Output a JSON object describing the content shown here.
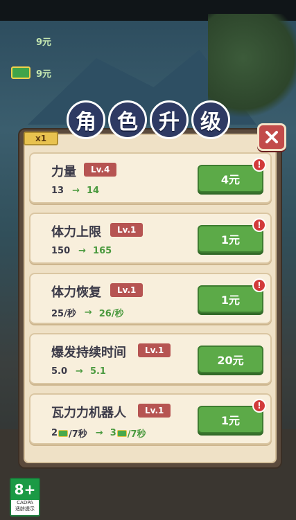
{
  "top_coins": [
    "9元",
    "9元"
  ],
  "title_chars": [
    "角",
    "色",
    "升",
    "级"
  ],
  "multiplier": "x1",
  "upgrades": [
    {
      "name": "力量",
      "level": "Lv.4",
      "from": "13",
      "to": "14",
      "price": "4元",
      "alert": true
    },
    {
      "name": "体力上限",
      "level": "Lv.1",
      "from": "150",
      "to": "165",
      "price": "1元",
      "alert": true
    },
    {
      "name": "体力恢复",
      "level": "Lv.1",
      "from": "25/秒",
      "to": "26/秒",
      "price": "1元",
      "alert": true
    },
    {
      "name": "爆发持续时间",
      "level": "Lv.1",
      "from": "5.0",
      "to": "5.1",
      "price": "20元",
      "alert": false
    },
    {
      "name": "瓦力力机器人",
      "level": "Lv.1",
      "from_num": "2",
      "from_unit": "/7秒",
      "to_num": "3",
      "to_unit": "/7秒",
      "price": "1元",
      "alert": true
    }
  ],
  "alert_mark": "!",
  "age_rating": {
    "age": "8+",
    "org": "CADPA",
    "label": "适龄提示"
  },
  "icons": {
    "close": "close-icon",
    "money": "money-stack-icon",
    "arrow": "→"
  }
}
